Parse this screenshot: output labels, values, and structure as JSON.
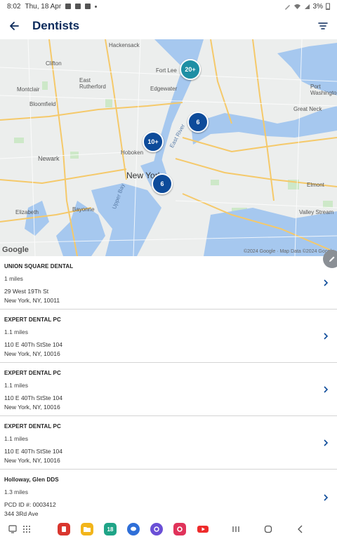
{
  "status_bar": {
    "time": "8:02",
    "date": "Thu, 18 Apr",
    "battery": "3%"
  },
  "app_bar": {
    "title": "Dentists",
    "back_icon": "arrow-left-icon",
    "filter_icon": "filter-icon"
  },
  "map": {
    "places": {
      "hackensack": "Hackensack",
      "clifton": "Clifton",
      "fort_lee": "Fort Lee",
      "east_rutherford": "East\nRutherford",
      "montclair": "Montclair",
      "edgewater": "Edgewater",
      "bloomfield": "Bloomfield",
      "great_neck": "Great Neck",
      "port_washington": "Port\nWashington",
      "hoboken": "Hoboken",
      "newark": "Newark",
      "new_york": "New York",
      "elmont": "Elmont",
      "elizabeth": "Elizabeth",
      "bayonne": "Bayonne",
      "valley_stream": "Valley Stream",
      "upper_bay": "Upper Bay",
      "east_river": "East River"
    },
    "clusters": [
      {
        "label": "20+",
        "color": "#1f8fa4"
      },
      {
        "label": "6",
        "color": "#0d4b9a"
      },
      {
        "label": "10+",
        "color": "#0d4b9a"
      },
      {
        "label": "6",
        "color": "#0d4b9a"
      }
    ],
    "google_logo": "Google",
    "attribution": "©2024 Google · Map Data ©2024 Google"
  },
  "dentists": [
    {
      "name": "UNION SQUARE DENTAL",
      "distance": "1 miles",
      "address1": "29 West 19Th St",
      "address2": "New York, NY, 10011"
    },
    {
      "name": "EXPERT DENTAL PC",
      "distance": "1.1 miles",
      "address1": "110 E 40Th StSte 104",
      "address2": "New York, NY, 10016"
    },
    {
      "name": "EXPERT DENTAL PC",
      "distance": "1.1 miles",
      "address1": "110 E 40Th StSte 104",
      "address2": "New York, NY, 10016"
    },
    {
      "name": "EXPERT DENTAL PC",
      "distance": "1.1 miles",
      "address1": "110 E 40Th StSte 104",
      "address2": "New York, NY, 10016"
    },
    {
      "name": "Holloway, Glen DDS",
      "distance": "1.3 miles",
      "pcd": "PCD ID #: 0003412",
      "address1": "344 3Rd Ave",
      "address2": ""
    }
  ],
  "nav_bar": {
    "calendar_day": "18",
    "colors": {
      "app1": "#d9362e",
      "folder": "#f2b51b",
      "calendar": "#1fa487",
      "chat": "#2f6fd8",
      "browser": "#6a4fd6",
      "camera": "#e0335a",
      "youtube": "#ee2b2b"
    }
  },
  "accent_color": "#0b2a5b"
}
